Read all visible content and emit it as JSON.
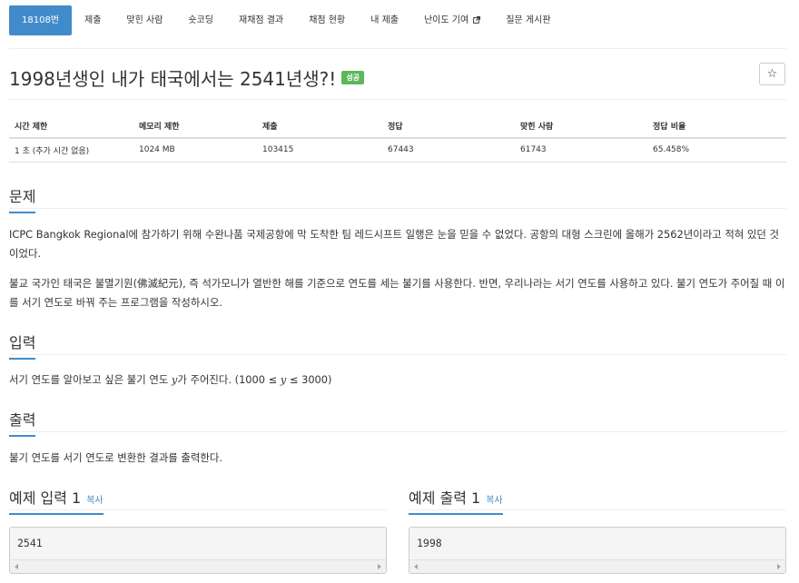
{
  "nav": {
    "items": [
      {
        "label": "18108번",
        "active": true
      },
      {
        "label": "제출"
      },
      {
        "label": "맞힌 사람"
      },
      {
        "label": "숏코딩"
      },
      {
        "label": "재채점 결과"
      },
      {
        "label": "채점 현황"
      },
      {
        "label": "내 제출"
      },
      {
        "label": "난이도 기여"
      },
      {
        "label": "질문 게시판"
      }
    ]
  },
  "problem": {
    "title": "1998년생인 내가 태국에서는 2541년생?!",
    "status_badge": "성공",
    "star_icon": "☆"
  },
  "info_table": {
    "headers": [
      "시간 제한",
      "메모리 제한",
      "제출",
      "정답",
      "맞힌 사람",
      "정답 비율"
    ],
    "values": [
      "1 초 (추가 시간 없음)",
      "1024 MB",
      "103415",
      "67443",
      "61743",
      "65.458%"
    ]
  },
  "sections": {
    "description": {
      "heading": "문제",
      "paragraph1": "ICPC Bangkok Regional에 참가하기 위해 수완나품 국제공항에 막 도착한 팀 레드시프트 일행은 눈을 믿을 수 없었다. 공항의 대형 스크린에 올해가 2562년이라고 적혀 있던 것이었다.",
      "paragraph2": "불교 국가인 태국은 불멸기원(佛滅紀元), 즉 석가모니가 열반한 해를 기준으로 연도를 세는 불기를 사용한다. 반면, 우리나라는 서기 연도를 사용하고 있다. 불기 연도가 주어질 때 이를 서기 연도로 바꿔 주는 프로그램을 작성하시오."
    },
    "input": {
      "heading": "입력",
      "text_before": "서기 연도를 알아보고 싶은 불기 연도 ",
      "var1": "y",
      "text_middle": "가 주어진다. (1000 ≤ ",
      "var2": "y",
      "text_after": " ≤ 3000)"
    },
    "output": {
      "heading": "출력",
      "text": "불기 연도를 서기 연도로 변환한 결과를 출력한다."
    }
  },
  "samples": {
    "input": {
      "heading": "예제 입력 1",
      "copy_label": "복사",
      "value": "2541"
    },
    "output": {
      "heading": "예제 출력 1",
      "copy_label": "복사",
      "value": "1998"
    }
  },
  "colors": {
    "accent": "#428bca",
    "success": "#5cb85c"
  }
}
